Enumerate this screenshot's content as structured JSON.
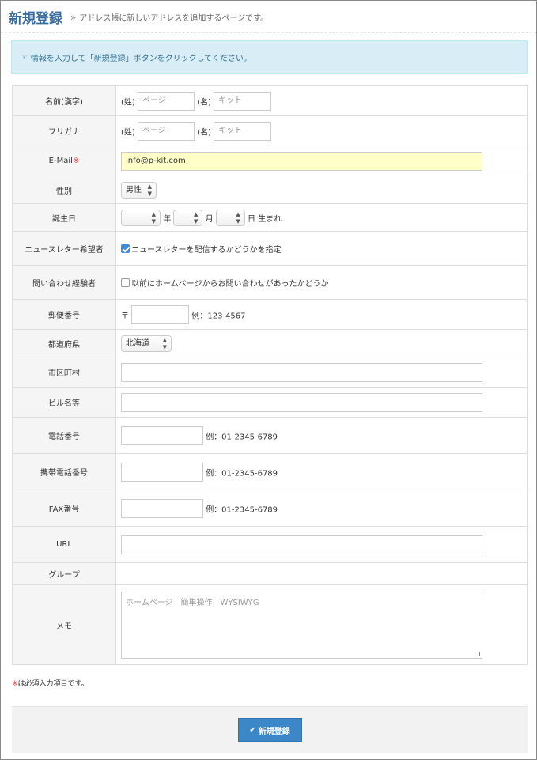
{
  "header": {
    "title": "新規登録",
    "subtitle": "アドレス帳に新しいアドレスを追加するページです。"
  },
  "alert": {
    "text": "情報を入力して「新規登録」ボタンをクリックしてください。"
  },
  "required_mark": "※",
  "form": {
    "name": {
      "label": "名前(漢字)",
      "sei_prefix": "(姓)",
      "sei_placeholder": "ページ",
      "mei_prefix": "(名)",
      "mei_placeholder": "キット"
    },
    "kana": {
      "label": "フリガナ",
      "sei_prefix": "(姓)",
      "sei_placeholder": "ページ",
      "mei_prefix": "(名)",
      "mei_placeholder": "キット"
    },
    "email": {
      "label": "E-Mail",
      "value": "info@p-kit.com"
    },
    "gender": {
      "label": "性別",
      "selected": "男性"
    },
    "birthday": {
      "label": "誕生日",
      "year_suffix": "年",
      "month_suffix": "月",
      "day_suffix": "日 生まれ"
    },
    "newsletter": {
      "label": "ニュースレター希望者",
      "checkbox_text": "ニュースレターを配信するかどうかを指定",
      "checked": true
    },
    "inquiry": {
      "label": "問い合わせ経験者",
      "checkbox_text": "以前にホームページからお問い合わせがあったかどうか",
      "checked": false
    },
    "postal": {
      "label": "郵便番号",
      "prefix": "〒",
      "example": "例：123-4567"
    },
    "prefecture": {
      "label": "都道府県",
      "selected": "北海道"
    },
    "city": {
      "label": "市区町村"
    },
    "building": {
      "label": "ビル名等"
    },
    "phone": {
      "label": "電話番号",
      "example": "例：01-2345-6789"
    },
    "mobile": {
      "label": "携帯電話番号",
      "example": "例：01-2345-6789"
    },
    "fax": {
      "label": "FAX番号",
      "example": "例：01-2345-6789"
    },
    "url": {
      "label": "URL"
    },
    "group": {
      "label": "グループ"
    },
    "memo": {
      "label": "メモ",
      "placeholder": "ホームページ　簡単操作　WYSIWYG"
    }
  },
  "footer": {
    "required_note": "は必須入力項目です。",
    "submit_label": "新規登録"
  },
  "colors": {
    "title": "#3a6b9e",
    "alert_bg": "#d9edf7",
    "email_bg": "#ffffc8",
    "button": "#3b87c8",
    "required": "#e33333"
  }
}
